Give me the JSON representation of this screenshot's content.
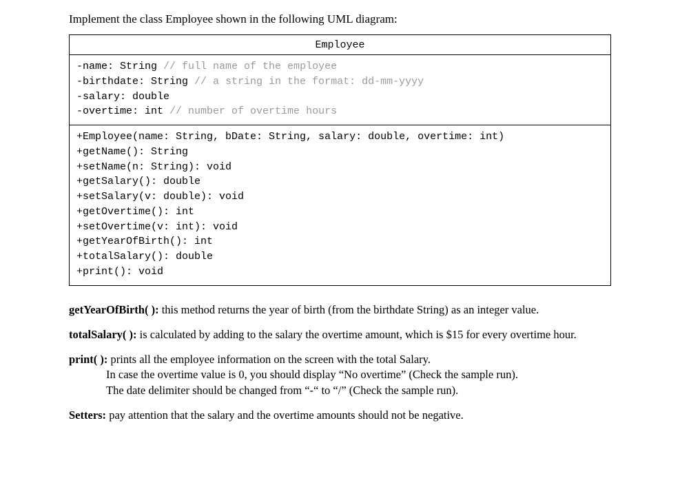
{
  "intro": "Implement the class Employee shown in the following UML diagram:",
  "uml": {
    "title": "Employee",
    "attributes": [
      {
        "plain": "-name: String ",
        "comment": "// full name of the employee"
      },
      {
        "plain": "-birthdate: String ",
        "comment": "// a string in the format: dd-mm-yyyy"
      },
      {
        "plain": "-salary: double",
        "comment": ""
      },
      {
        "plain": "-overtime: int   ",
        "comment": "// number of overtime hours"
      }
    ],
    "methods": [
      "+Employee(name: String, bDate: String, salary: double, overtime: int)",
      "+getName(): String",
      "+setName(n: String): void",
      "+getSalary(): double",
      "+setSalary(v: double): void",
      "+getOvertime(): int",
      "+setOvertime(v: int): void",
      "+getYearOfBirth(): int",
      "+totalSalary(): double",
      "+print(): void"
    ]
  },
  "descriptions": {
    "getYearOfBirth": {
      "name": "getYearOfBirth( ):",
      "text": " this method returns the year of birth (from the birthdate String) as an integer value."
    },
    "totalSalary": {
      "name": "totalSalary( ):",
      "text": " is calculated by adding to the salary the overtime amount, which is $15 for every overtime hour."
    },
    "print": {
      "name": "print( ):",
      "text1": " prints all the employee information on the screen with the total Salary.",
      "text2": "In case the overtime value is 0, you should display “No overtime” (Check the sample run).",
      "text3": "The date delimiter should be changed from “-“  to “/” (Check the sample run)."
    },
    "setters": {
      "name": "Setters:",
      "text": " pay attention that the salary and the overtime amounts should not be negative."
    }
  }
}
